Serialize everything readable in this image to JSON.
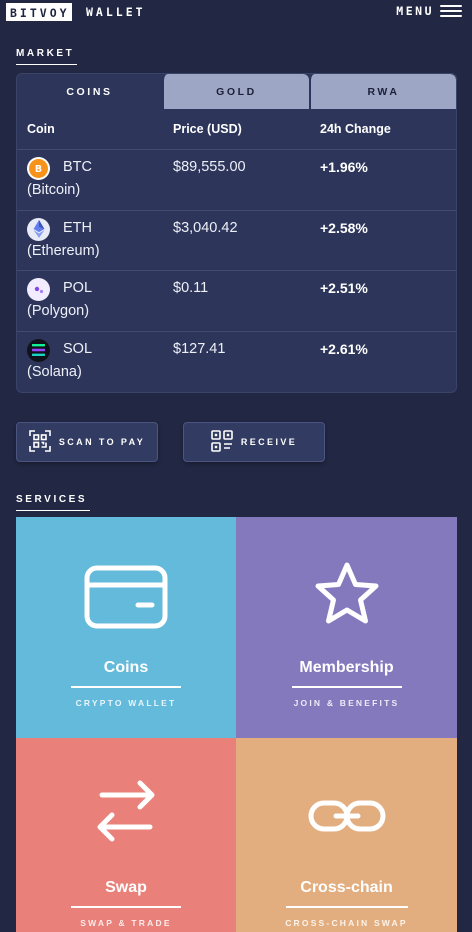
{
  "header": {
    "logo": "BITVOY",
    "logo_suffix": "WALLET",
    "menu_label": "MENU"
  },
  "market": {
    "section_label": "MARKET",
    "tabs": [
      {
        "label": "COINS",
        "active": true
      },
      {
        "label": "GOLD",
        "active": false
      },
      {
        "label": "RWA",
        "active": false
      }
    ],
    "columns": [
      "Coin",
      "Price (USD)",
      "24h Change"
    ],
    "rows": [
      {
        "symbol": "BTC",
        "name": "(Bitcoin)",
        "price": "$89,555.00",
        "change": "+1.96%",
        "icon": "bitcoin-icon",
        "icon_color": "#f7931a"
      },
      {
        "symbol": "ETH",
        "name": "(Ethereum)",
        "price": "$3,040.42",
        "change": "+2.58%",
        "icon": "ethereum-icon",
        "icon_color": "#627eea"
      },
      {
        "symbol": "POL",
        "name": "(Polygon)",
        "price": "$0.11",
        "change": "+2.51%",
        "icon": "polygon-icon",
        "icon_color": "#8247e5"
      },
      {
        "symbol": "SOL",
        "name": "(Solana)",
        "price": "$127.41",
        "change": "+2.61%",
        "icon": "solana-icon",
        "icon_color": "#14f195"
      }
    ]
  },
  "actions": {
    "scan_label": "SCAN TO PAY",
    "receive_label": "RECEIVE"
  },
  "services": {
    "section_label": "SERVICES",
    "tiles": [
      {
        "title": "Coins",
        "subtitle": "CRYPTO WALLET",
        "icon": "card-icon",
        "color": "#64badb"
      },
      {
        "title": "Membership",
        "subtitle": "JOIN & BENEFITS",
        "icon": "star-icon",
        "color": "#8579be"
      },
      {
        "title": "Swap",
        "subtitle": "SWAP & TRADE",
        "icon": "swap-arrows-icon",
        "color": "#e9807a"
      },
      {
        "title": "Cross-chain",
        "subtitle": "CROSS-CHAIN SWAP",
        "icon": "chain-link-icon",
        "color": "#e3ae7f"
      }
    ]
  }
}
